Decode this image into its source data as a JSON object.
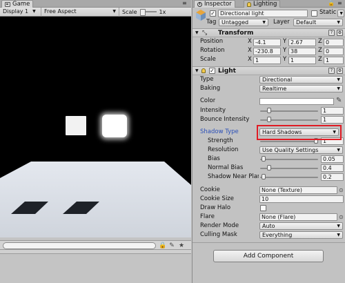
{
  "game": {
    "tab_label": "Game",
    "toolbar": {
      "display": "Display 1",
      "aspect": "Free Aspect",
      "scale_label": "Scale",
      "scale_value": "1x"
    }
  },
  "inspector": {
    "tabs": {
      "inspector": "Inspector",
      "lighting": "Lighting"
    },
    "object": {
      "name": "Directional light",
      "static_label": "Static",
      "tag_label": "Tag",
      "tag_value": "Untagged",
      "layer_label": "Layer",
      "layer_value": "Default"
    },
    "transform": {
      "title": "Transform",
      "rows": [
        {
          "label": "Position",
          "x": "-4.1",
          "y": "2.67",
          "z": "0"
        },
        {
          "label": "Rotation",
          "x": "-230.8",
          "y": "38",
          "z": "0"
        },
        {
          "label": "Scale",
          "x": "1",
          "y": "1",
          "z": "1"
        }
      ]
    },
    "light": {
      "title": "Light",
      "type_label": "Type",
      "type_value": "Directional",
      "baking_label": "Baking",
      "baking_value": "Realtime",
      "color_label": "Color",
      "intensity_label": "Intensity",
      "intensity_value": "1",
      "bounce_label": "Bounce Intensity",
      "bounce_value": "1",
      "shadow_type_label": "Shadow Type",
      "shadow_type_value": "Hard Shadows",
      "strength_label": "Strength",
      "strength_value": "1",
      "resolution_label": "Resolution",
      "resolution_value": "Use Quality Settings",
      "bias_label": "Bias",
      "bias_value": "0.05",
      "normal_bias_label": "Normal Bias",
      "normal_bias_value": "0.4",
      "near_plane_label": "Shadow Near Plar",
      "near_plane_value": "0.2",
      "cookie_label": "Cookie",
      "cookie_value": "None (Texture)",
      "cookie_size_label": "Cookie Size",
      "cookie_size_value": "10",
      "draw_halo_label": "Draw Halo",
      "flare_label": "Flare",
      "flare_value": "None (Flare)",
      "render_mode_label": "Render Mode",
      "render_mode_value": "Auto",
      "culling_label": "Culling Mask",
      "culling_value": "Everything"
    },
    "axis": {
      "x": "X",
      "y": "Y",
      "z": "Z"
    },
    "add_component": "Add Component"
  },
  "colors": {
    "highlight": "#e01b24",
    "shadow_type_label": "#2a4fb8"
  },
  "levels": {
    "intensity": 0.125,
    "bounce": 0.125,
    "strength": 1.0,
    "bias": 0.025,
    "normal_bias": 0.13,
    "near_plane": 0.02
  }
}
